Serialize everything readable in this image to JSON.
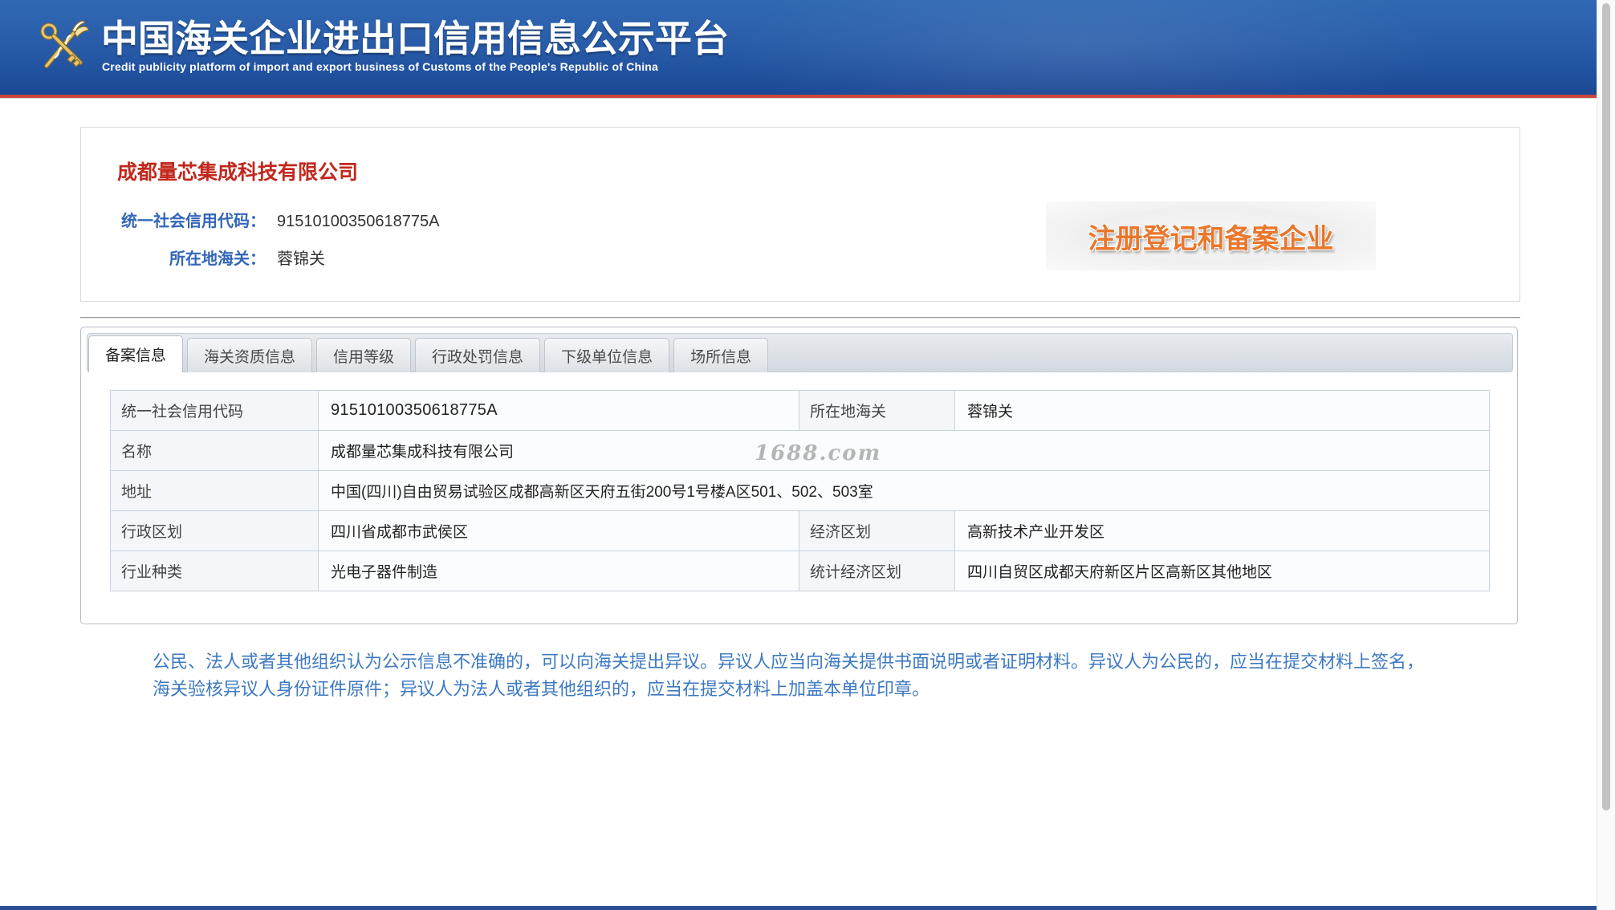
{
  "header": {
    "title": "中国海关企业进出口信用信息公示平台",
    "subtitle": "Credit publicity platform of import and export business of Customs of the People's Republic of China",
    "logo_icon": "customs-emblem-icon"
  },
  "company": {
    "name": "成都量芯集成科技有限公司",
    "fields": [
      {
        "label": "统一社会信用代码：",
        "value": "91510100350618775A"
      },
      {
        "label": "所在地海关：",
        "value": "蓉锦关"
      }
    ],
    "badge": "注册登记和备案企业"
  },
  "tabs": [
    {
      "label": "备案信息",
      "active": true
    },
    {
      "label": "海关资质信息",
      "active": false
    },
    {
      "label": "信用等级",
      "active": false
    },
    {
      "label": "行政处罚信息",
      "active": false
    },
    {
      "label": "下级单位信息",
      "active": false
    },
    {
      "label": "场所信息",
      "active": false
    }
  ],
  "record_table": {
    "rows": [
      {
        "cells": [
          {
            "label": "统一社会信用代码",
            "value": "91510100350618775A"
          },
          {
            "label": "所在地海关",
            "value": "蓉锦关"
          }
        ]
      },
      {
        "cells": [
          {
            "label": "名称",
            "value": "成都量芯集成科技有限公司"
          }
        ]
      },
      {
        "cells": [
          {
            "label": "地址",
            "value": "中国(四川)自由贸易试验区成都高新区天府五街200号1号楼A区501、502、503室"
          }
        ]
      },
      {
        "cells": [
          {
            "label": "行政区划",
            "value": "四川省成都市武侯区"
          },
          {
            "label": "经济区划",
            "value": "高新技术产业开发区"
          }
        ]
      },
      {
        "cells": [
          {
            "label": "行业种类",
            "value": "光电子器件制造"
          },
          {
            "label": "统计经济区划",
            "value": "四川自贸区成都天府新区片区高新区其他地区"
          }
        ]
      }
    ]
  },
  "watermark": "1688.com",
  "notice": {
    "line1": "公民、法人或者其他组织认为公示信息不准确的，可以向海关提出异议。异议人应当向海关提供书面说明或者证明材料。异议人为公民的，应当在提交材料上签名，",
    "line2": "海关验核异议人身份证件原件；异议人为法人或者其他组织的，应当在提交材料上加盖本单位印章。"
  },
  "colors": {
    "header_blue": "#2458a5",
    "header_rule": "#c9473d",
    "company_name": "#c0281e",
    "label_blue": "#3366b8",
    "notice_blue": "#3d79c2",
    "badge_orange": "#e9772c"
  }
}
